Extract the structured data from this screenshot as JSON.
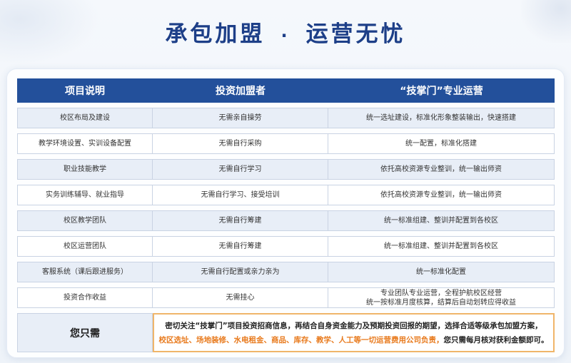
{
  "header": {
    "title_left": "承包加盟",
    "separator": "·",
    "title_right": "运营无忧"
  },
  "table": {
    "columns": [
      "项目说明",
      "投资加盟者",
      "“技掌门”专业运营"
    ],
    "rows": [
      {
        "item": "校区布局及建设",
        "investor": "无需亲自操劳",
        "operator": [
          "统一选址建设，标准化形象整装输出，快速搭建"
        ]
      },
      {
        "item": "教学环境设置、实训设备配置",
        "investor": "无需自行采购",
        "operator": [
          "统一配置，标准化搭建"
        ]
      },
      {
        "item": "职业技能教学",
        "investor": "无需自行学习",
        "operator": [
          "依托高校资源专业整训，统一输出师资"
        ]
      },
      {
        "item": "实务训练辅导、就业指导",
        "investor": "无需自行学习、接受培训",
        "operator": [
          "依托高校资源专业整训，统一输出师资"
        ]
      },
      {
        "item": "校区教学团队",
        "investor": "无需自行筹建",
        "operator": [
          "统一标准组建、整训并配置到各校区"
        ]
      },
      {
        "item": "校区运营团队",
        "investor": "无需自行筹建",
        "operator": [
          "统一标准组建、整训并配置到各校区"
        ]
      },
      {
        "item": "客服系统（课后跟进服务）",
        "investor": "无需自行配置或亲力亲为",
        "operator": [
          "统一标准化配置"
        ]
      },
      {
        "item": "投资合作收益",
        "investor": "无需挂心",
        "operator": [
          "专业团队专业运营，全程护航校区经营",
          "统一按标准月度核算，结算后自动划转应得收益"
        ]
      }
    ]
  },
  "footer": {
    "label": "您只需",
    "line1": "密切关注“技掌门”项目投资招商信息，再结合自身资金能力及预期投资回报的期望，选择合适等级承包加盟方案，",
    "line2_highlight": "校区选址、场地装修、水电租金、商品、库存、教学、人工等一切运营费用公司负责，",
    "line2_rest": "您只需每月核对获利金额即可。"
  },
  "colors": {
    "title": "#1d3f88",
    "header_bg": "#23509b",
    "row_shade": "#e8eef7",
    "highlight": "#e87a1d",
    "footer_border": "#f0b56a"
  }
}
